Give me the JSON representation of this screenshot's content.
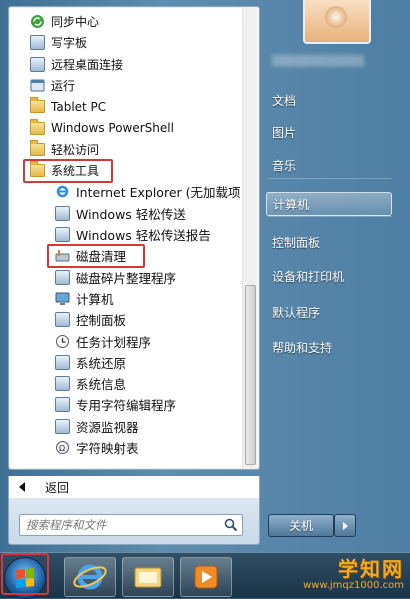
{
  "programs": [
    {
      "label": "同步中心",
      "icon": "sync-center-icon",
      "level": 0
    },
    {
      "label": "写字板",
      "icon": "wordpad-icon",
      "level": 0
    },
    {
      "label": "远程桌面连接",
      "icon": "remote-desktop-icon",
      "level": 0
    },
    {
      "label": "运行",
      "icon": "run-icon",
      "level": 0
    },
    {
      "label": "Tablet PC",
      "icon": "folder-icon",
      "level": 0
    },
    {
      "label": "Windows PowerShell",
      "icon": "folder-icon",
      "level": 0
    },
    {
      "label": "轻松访问",
      "icon": "folder-icon",
      "level": 0
    },
    {
      "label": "系统工具",
      "icon": "folder-icon",
      "level": 0,
      "highlighted": true
    },
    {
      "label": "Internet Explorer (无加载项)",
      "icon": "internet-explorer-icon",
      "level": 1
    },
    {
      "label": "Windows 轻松传送",
      "icon": "easy-transfer-icon",
      "level": 1
    },
    {
      "label": "Windows 轻松传送报告",
      "icon": "easy-transfer-report-icon",
      "level": 1
    },
    {
      "label": "磁盘清理",
      "icon": "disk-cleanup-icon",
      "level": 1,
      "highlighted": true
    },
    {
      "label": "磁盘碎片整理程序",
      "icon": "defragmenter-icon",
      "level": 1
    },
    {
      "label": "计算机",
      "icon": "computer-icon",
      "level": 1
    },
    {
      "label": "控制面板",
      "icon": "control-panel-icon",
      "level": 1
    },
    {
      "label": "任务计划程序",
      "icon": "task-scheduler-icon",
      "level": 1
    },
    {
      "label": "系统还原",
      "icon": "system-restore-icon",
      "level": 1
    },
    {
      "label": "系统信息",
      "icon": "system-info-icon",
      "level": 1
    },
    {
      "label": "专用字符编辑程序",
      "icon": "char-editor-icon",
      "level": 1
    },
    {
      "label": "资源监视器",
      "icon": "resource-monitor-icon",
      "level": 1
    },
    {
      "label": "字符映射表",
      "icon": "character-map-icon",
      "level": 1
    }
  ],
  "back_label": "返回",
  "search": {
    "placeholder": "搜索程序和文件"
  },
  "right_items": [
    {
      "label": "文档"
    },
    {
      "label": "图片"
    },
    {
      "label": "音乐"
    },
    {
      "label": "计算机",
      "selected": true
    },
    {
      "label": "控制面板"
    },
    {
      "label": "设备和打印机"
    },
    {
      "label": "默认程序"
    },
    {
      "label": "帮助和支持"
    }
  ],
  "shutdown_label": "关机",
  "watermark": {
    "title": "学知网",
    "url": "www.jmqz1000.com"
  },
  "colors": {
    "highlight_border": "#d23a3a",
    "watermark": "#f4ab23"
  }
}
